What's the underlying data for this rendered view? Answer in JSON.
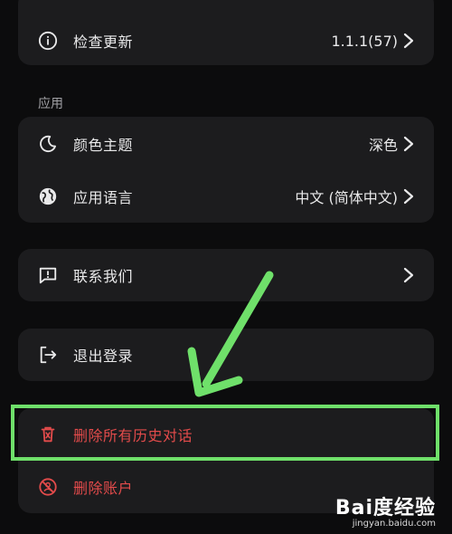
{
  "about": {
    "check_update_label": "检查更新",
    "version": "1.1.1(57)"
  },
  "app_section": {
    "header": "应用",
    "theme_label": "颜色主题",
    "theme_value": "深色",
    "language_label": "应用语言",
    "language_value": "中文 (简体中文)"
  },
  "contact": {
    "label": "联系我们"
  },
  "logout": {
    "label": "退出登录"
  },
  "danger_zone": {
    "delete_history_label": "删除所有历史对话",
    "delete_account_label": "删除账户"
  },
  "watermark": {
    "brand": "Bai度经验",
    "url": "jingyan.baidu.com"
  },
  "colors": {
    "background": "#0c0c0d",
    "card": "#1c1c1e",
    "danger": "#e34b4b",
    "highlight": "#6fe06a"
  },
  "icons": {
    "check_update": "info-icon",
    "theme": "moon-icon",
    "language": "globe-icon",
    "contact": "feedback-icon",
    "logout": "logout-icon",
    "delete_history": "trash-icon",
    "delete_account": "block-icon",
    "chevron": "chevron-right-icon"
  }
}
